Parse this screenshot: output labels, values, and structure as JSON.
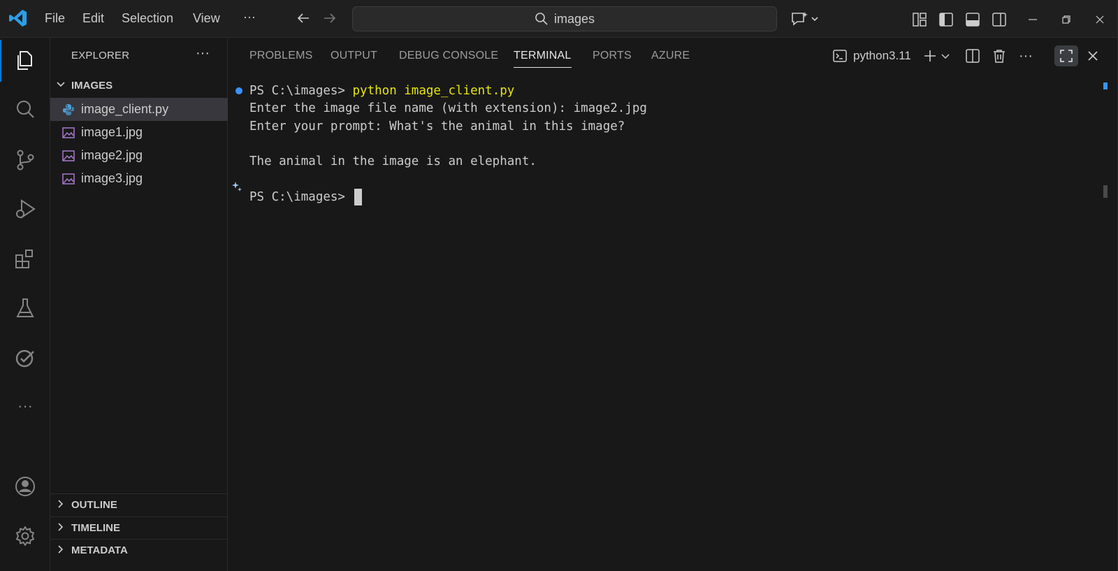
{
  "menu": [
    "File",
    "Edit",
    "Selection",
    "View",
    "···"
  ],
  "search": {
    "text": "images"
  },
  "sidebar": {
    "title": "EXPLORER",
    "more": "···",
    "folder": "IMAGES",
    "files": [
      {
        "name": "image_client.py",
        "icon": "python-file-icon"
      },
      {
        "name": "image1.jpg",
        "icon": "image-file-icon"
      },
      {
        "name": "image2.jpg",
        "icon": "image-file-icon"
      },
      {
        "name": "image3.jpg",
        "icon": "image-file-icon"
      }
    ],
    "bottom_sections": [
      "OUTLINE",
      "TIMELINE",
      "METADATA"
    ]
  },
  "panel": {
    "tabs": [
      "PROBLEMS",
      "OUTPUT",
      "DEBUG CONSOLE",
      "TERMINAL",
      "PORTS",
      "AZURE"
    ],
    "active_tab": "TERMINAL",
    "terminal_name": "python3.11"
  },
  "terminal": {
    "prompt1": "PS C:\\images> ",
    "command": "python image_client.py",
    "line2": "Enter the image file name (with extension): image2.jpg",
    "line3": "Enter your prompt: What's the animal in this image?",
    "line4": "The animal in the image is an elephant.",
    "prompt2": "PS C:\\images> "
  },
  "colors": {
    "accent": "#0078d4",
    "command_yellow": "#e5e510",
    "decoration_blue": "#3794ff",
    "python_icon": "#4d9fd6",
    "image_icon": "#a074c4"
  }
}
